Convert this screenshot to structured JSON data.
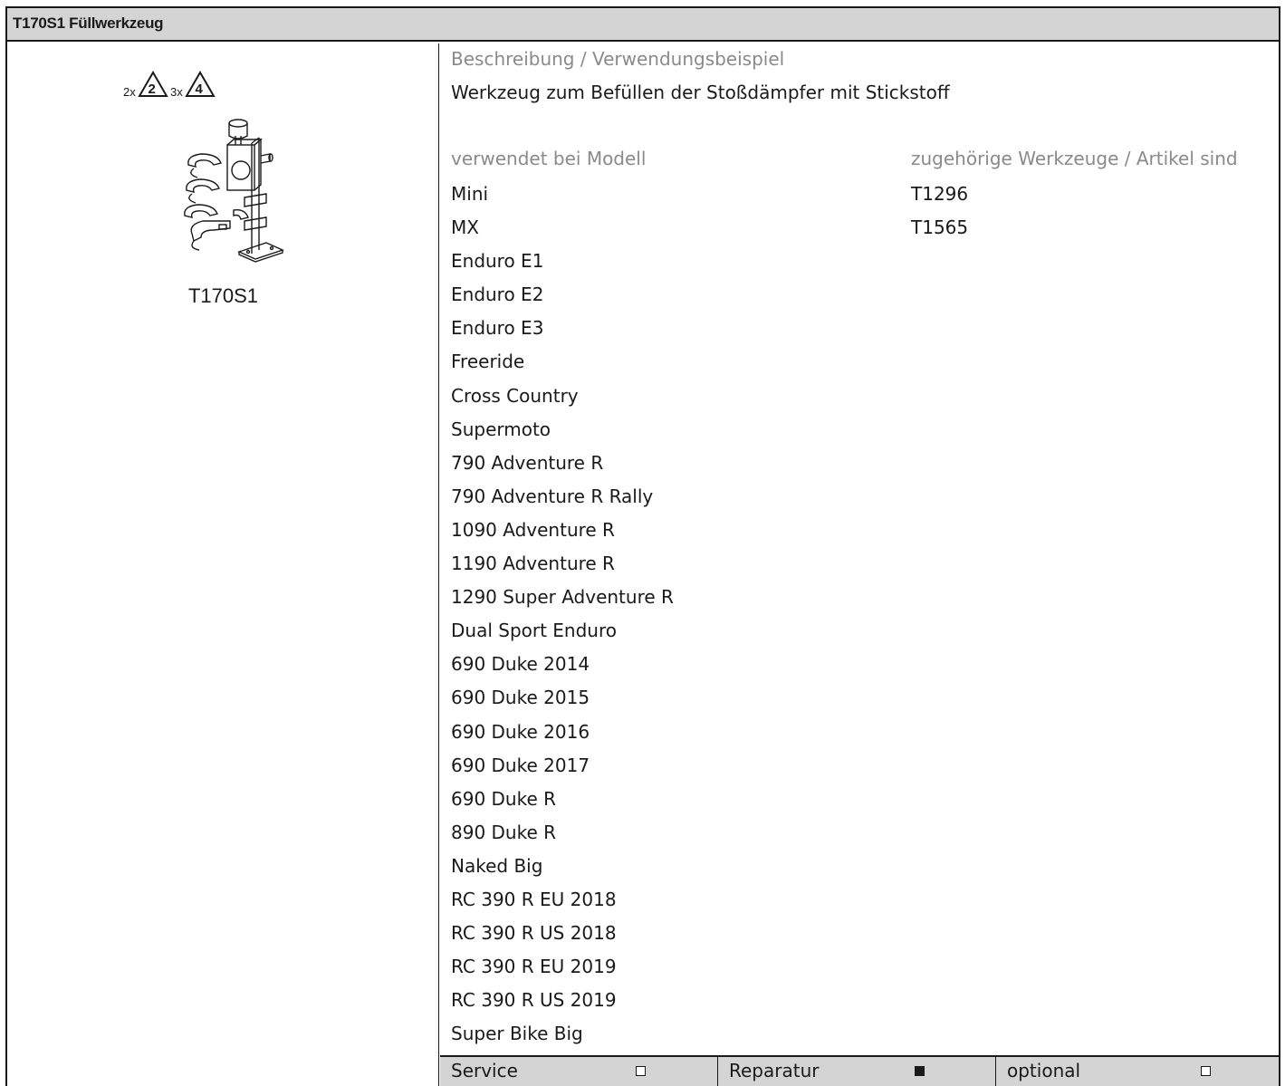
{
  "title": "T170S1 Füllwerkzeug",
  "figure": {
    "caption": "T170S1",
    "warnings": [
      {
        "count": "2x",
        "level": "2"
      },
      {
        "count": "3x",
        "level": "4"
      }
    ]
  },
  "description": {
    "label": "Beschreibung / Verwendungsbeispiel",
    "text": "Werkzeug zum Befüllen der Stoßdämpfer mit Stickstoff"
  },
  "models": {
    "label": "verwendet bei Modell",
    "items": [
      "Mini",
      "MX",
      "Enduro E1",
      "Enduro E2",
      "Enduro E3",
      "Freeride",
      "Cross Country",
      "Supermoto",
      "790 Adventure R",
      "790 Adventure R Rally",
      "1090 Adventure R",
      "1190 Adventure R",
      "1290 Super Adventure R",
      "Dual Sport Enduro",
      "690 Duke 2014",
      "690 Duke 2015",
      "690 Duke 2016",
      "690 Duke 2017",
      "690 Duke R",
      "890 Duke R",
      "Naked Big",
      "RC 390 R EU 2018",
      "RC 390 R US 2018",
      "RC 390 R EU 2019",
      "RC 390 R US 2019",
      "Super Bike Big"
    ]
  },
  "related": {
    "label": "zugehörige Werkzeuge / Artikel sind",
    "items": [
      "T1296",
      "T1565"
    ]
  },
  "footer": {
    "service": {
      "label": "Service",
      "checked": false
    },
    "reparatur": {
      "label": "Reparatur",
      "checked": true
    },
    "optional": {
      "label": "optional",
      "checked": false
    }
  }
}
